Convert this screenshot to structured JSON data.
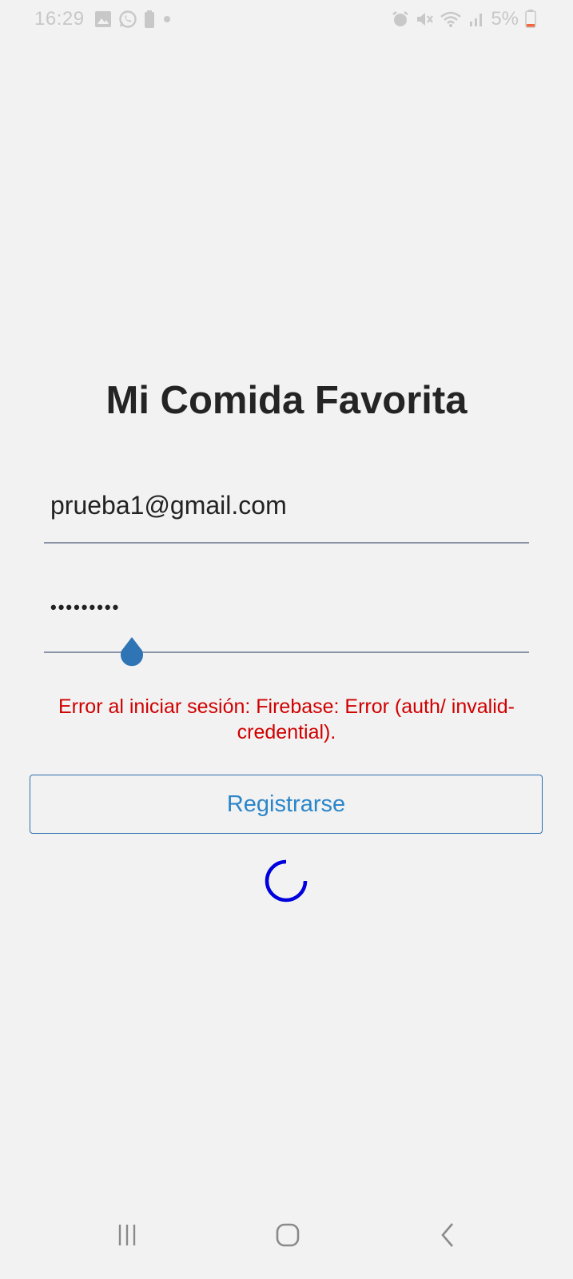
{
  "status_bar": {
    "time": "16:29",
    "battery_percent": "5%",
    "left_icons": [
      "gallery-icon",
      "whatsapp-icon",
      "battery-saver-icon",
      "dot-icon"
    ],
    "right_icons": [
      "alarm-icon",
      "mute-icon",
      "wifi-icon",
      "signal-icon",
      "battery-icon"
    ]
  },
  "app": {
    "title": "Mi Comida Favorita"
  },
  "login_form": {
    "email_value": "prueba1@gmail.com",
    "password_value": "•••••••••",
    "error_message": "Error al iniciar sesión: Firebase: Error (auth/ invalid-credential).",
    "register_label": "Registrarse"
  },
  "colors": {
    "background": "#f2f2f2",
    "error": "#d00000",
    "accent": "#2b86c9",
    "spinner": "#0000dd",
    "cursor_handle": "#2f74b5"
  },
  "nav_bar": {
    "buttons": [
      "recents-icon",
      "home-icon",
      "back-icon"
    ]
  }
}
